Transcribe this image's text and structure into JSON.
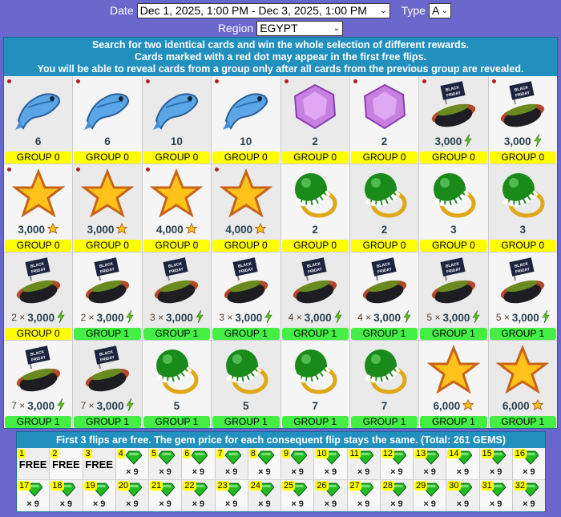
{
  "filters": {
    "date_label": "Date",
    "date_value": "Dec 1, 2025, 1:00 PM - Dec 3, 2025, 1:00 PM",
    "type_label": "Type",
    "type_value": "A",
    "region_label": "Region",
    "region_value": "EGYPT"
  },
  "info": [
    "Search for two identical cards and win the whole selection of different rewards.",
    "Cards marked with a red dot may appear in the first free flips.",
    "You will be able to reveal cards from a group only after all cards from the previous group are revealed."
  ],
  "cards": [
    {
      "icon": "fish",
      "value": "6",
      "group": "GROUP 0",
      "dot": true
    },
    {
      "icon": "fish",
      "value": "6",
      "group": "GROUP 0",
      "dot": true
    },
    {
      "icon": "fish",
      "value": "10",
      "group": "GROUP 0",
      "dot": true
    },
    {
      "icon": "fish",
      "value": "10",
      "group": "GROUP 0",
      "dot": true
    },
    {
      "icon": "gem",
      "value": "2",
      "group": "GROUP 0",
      "dot": true
    },
    {
      "icon": "gem",
      "value": "2",
      "group": "GROUP 0",
      "dot": true
    },
    {
      "icon": "hotdog",
      "value": "3,000",
      "unit": "bolt",
      "group": "GROUP 0",
      "dot": true
    },
    {
      "icon": "hotdog",
      "value": "3,000",
      "unit": "bolt",
      "group": "GROUP 0",
      "dot": true
    },
    {
      "icon": "star",
      "value": "3,000",
      "unit": "star",
      "group": "GROUP 0",
      "dot": true
    },
    {
      "icon": "star",
      "value": "3,000",
      "unit": "star",
      "group": "GROUP 0",
      "dot": true
    },
    {
      "icon": "star",
      "value": "4,000",
      "unit": "star",
      "group": "GROUP 0",
      "dot": true
    },
    {
      "icon": "star",
      "value": "4,000",
      "unit": "star",
      "group": "GROUP 0",
      "dot": true
    },
    {
      "icon": "ring",
      "value": "2",
      "group": "GROUP 0"
    },
    {
      "icon": "ring",
      "value": "2",
      "group": "GROUP 0"
    },
    {
      "icon": "ring",
      "value": "3",
      "group": "GROUP 0"
    },
    {
      "icon": "ring",
      "value": "3",
      "group": "GROUP 0"
    },
    {
      "icon": "hotdog",
      "mult": "2 ×",
      "value": "3,000",
      "unit": "bolt",
      "group": "GROUP 0"
    },
    {
      "icon": "hotdog",
      "mult": "2 ×",
      "value": "3,000",
      "unit": "bolt",
      "group": "GROUP 1"
    },
    {
      "icon": "hotdog",
      "mult": "3 ×",
      "value": "3,000",
      "unit": "bolt",
      "group": "GROUP 1"
    },
    {
      "icon": "hotdog",
      "mult": "3 ×",
      "value": "3,000",
      "unit": "bolt",
      "group": "GROUP 1"
    },
    {
      "icon": "hotdog",
      "mult": "4 ×",
      "value": "3,000",
      "unit": "bolt",
      "group": "GROUP 1"
    },
    {
      "icon": "hotdog",
      "mult": "4 ×",
      "value": "3,000",
      "unit": "bolt",
      "group": "GROUP 1"
    },
    {
      "icon": "hotdog",
      "mult": "5 ×",
      "value": "3,000",
      "unit": "bolt",
      "group": "GROUP 1"
    },
    {
      "icon": "hotdog",
      "mult": "5 ×",
      "value": "3,000",
      "unit": "bolt",
      "group": "GROUP 1"
    },
    {
      "icon": "hotdog",
      "mult": "7 ×",
      "value": "3,000",
      "unit": "bolt",
      "group": "GROUP 1"
    },
    {
      "icon": "hotdog",
      "mult": "7 ×",
      "value": "3,000",
      "unit": "bolt",
      "group": "GROUP 1"
    },
    {
      "icon": "ring",
      "value": "5",
      "group": "GROUP 1"
    },
    {
      "icon": "ring",
      "value": "5",
      "group": "GROUP 1"
    },
    {
      "icon": "ring",
      "value": "7",
      "group": "GROUP 1"
    },
    {
      "icon": "ring",
      "value": "7",
      "group": "GROUP 1"
    },
    {
      "icon": "star",
      "value": "6,000",
      "unit": "star",
      "group": "GROUP 1"
    },
    {
      "icon": "star",
      "value": "6,000",
      "unit": "star",
      "group": "GROUP 1"
    }
  ],
  "flips": {
    "header": "First 3 flips are free. The gem price for each consequent flip stays the same. (Total: 261 GEMS)",
    "free_label": "FREE",
    "price_label": "× 9",
    "free_count": 3,
    "count": 32
  },
  "colors": {
    "background": "#6a67cc",
    "header": "#2190bf",
    "group0": "#ffff00",
    "group1": "#44ee44"
  }
}
